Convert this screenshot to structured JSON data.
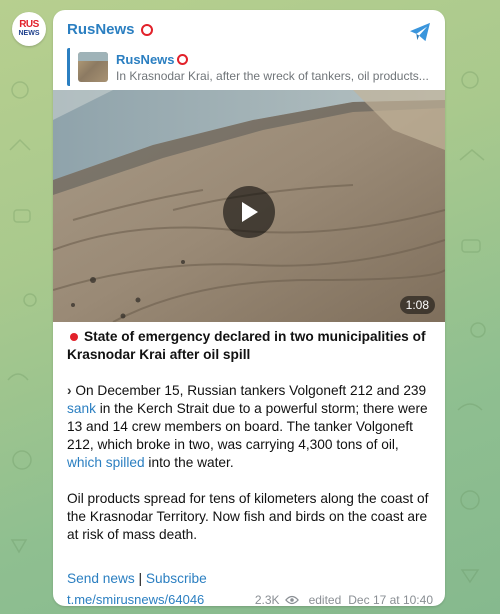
{
  "channel": {
    "name": "RusNews",
    "avatar_text_top": "RUS",
    "avatar_text_bottom": "NEWS"
  },
  "reply": {
    "name": "RusNews",
    "text": "In Krasnodar Krai, after the wreck of tankers, oil products..."
  },
  "video": {
    "duration": "1:08"
  },
  "post": {
    "headline": "State of emergency declared in two municipalities of Krasnodar Krai after oil spill",
    "p1_a": "On December 15, Russian tankers Volgoneft 212 and 239 ",
    "p1_link1": "sank",
    "p1_b": " in the Kerch Strait due to a powerful storm; there were 13 and 14 crew members on board. The tanker Volgoneft 212, which broke in two, was carrying 4,300 tons of oil, ",
    "p1_link2": "which spilled",
    "p1_c": " into the water.",
    "p2": "Oil products spread for tens of kilometers along the coast of the Krasnodar Territory. Now fish and birds on the coast are at risk of mass death."
  },
  "links": {
    "send_news": "Send news",
    "separator": " | ",
    "subscribe": "Subscribe"
  },
  "meta": {
    "url": "t.me/smirusnews/64046",
    "views": "2.3K",
    "edited": "edited",
    "date": "Dec 17 at 10:40"
  },
  "colors": {
    "accent": "#2b7fc1",
    "red": "#e2212a"
  }
}
